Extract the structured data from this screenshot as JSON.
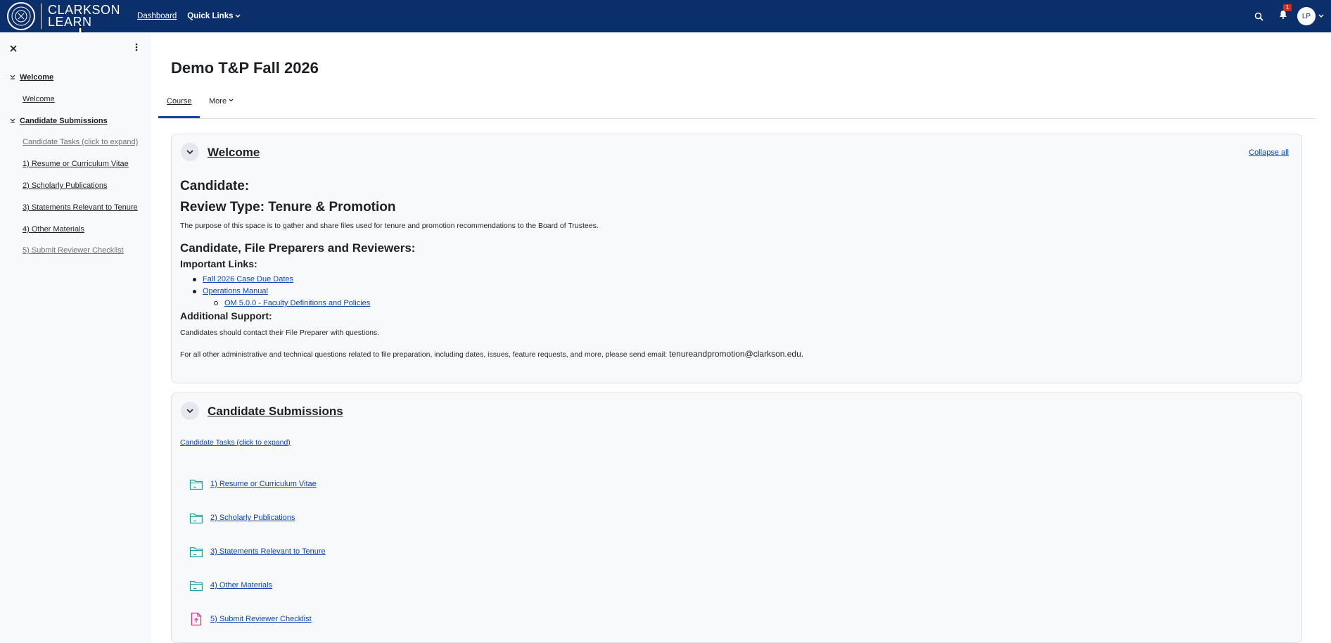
{
  "header": {
    "logo_line1": "CLARKSON",
    "logo_line2": "LEARN",
    "nav_dashboard": "Dashboard",
    "nav_quick_links": "Quick Links",
    "notification_count": "1",
    "avatar_initials": "LP",
    "brand_color": "#0a2f6b"
  },
  "drawer": {
    "sections": [
      {
        "title": "Welcome",
        "items": [
          "Welcome"
        ]
      },
      {
        "title": "Candidate Submissions",
        "items": [
          "Candidate Tasks (click to expand)",
          "1) Resume or Curriculum Vitae",
          "2) Scholarly Publications",
          "3) Statements Relevant to Tenure",
          "4) Other Materials",
          "5) Submit Reviewer Checklist"
        ]
      }
    ]
  },
  "page": {
    "title": "Demo T&P Fall 2026",
    "tabs": [
      "Course",
      "More"
    ]
  },
  "welcome_section": {
    "title": "Welcome",
    "collapse_all": "Collapse all",
    "candidate_heading": "Candidate:",
    "review_type_heading": "Review Type: Tenure & Promotion",
    "purpose_text": "The purpose of this space is to gather and share files used for tenure and promotion recommendations to the Board of Trustees.",
    "cfpr_heading": "Candidate, File Preparers and Reviewers:",
    "important_links_heading": "Important Links:",
    "links": [
      "Fall 2026 Case Due Dates",
      "Operations Manual"
    ],
    "sublinks": [
      "OM 5.0.0 - Faculty Definitions and Policies"
    ],
    "additional_support_heading": "Additional Support:",
    "support_text1": "Candidates should contact their File Preparer with questions.",
    "support_text2": "For all other administrative and technical questions related to file preparation, including dates, issues, feature requests, and more, please send email: ",
    "support_email": "tenureandpromotion@clarkson.edu."
  },
  "submissions_section": {
    "title": "Candidate Submissions",
    "tasks_link": "Candidate Tasks (click to expand)",
    "activities": [
      {
        "label": "1) Resume or Curriculum Vitae",
        "icon": "folder-icon"
      },
      {
        "label": "2) Scholarly Publications",
        "icon": "folder-icon"
      },
      {
        "label": "3) Statements Relevant to Tenure",
        "icon": "folder-icon"
      },
      {
        "label": "4) Other Materials",
        "icon": "folder-icon"
      },
      {
        "label": "5) Submit Reviewer Checklist",
        "icon": "assignment-icon"
      }
    ],
    "folder_color": "#1aa3a3",
    "assignment_color": "#d63384"
  }
}
